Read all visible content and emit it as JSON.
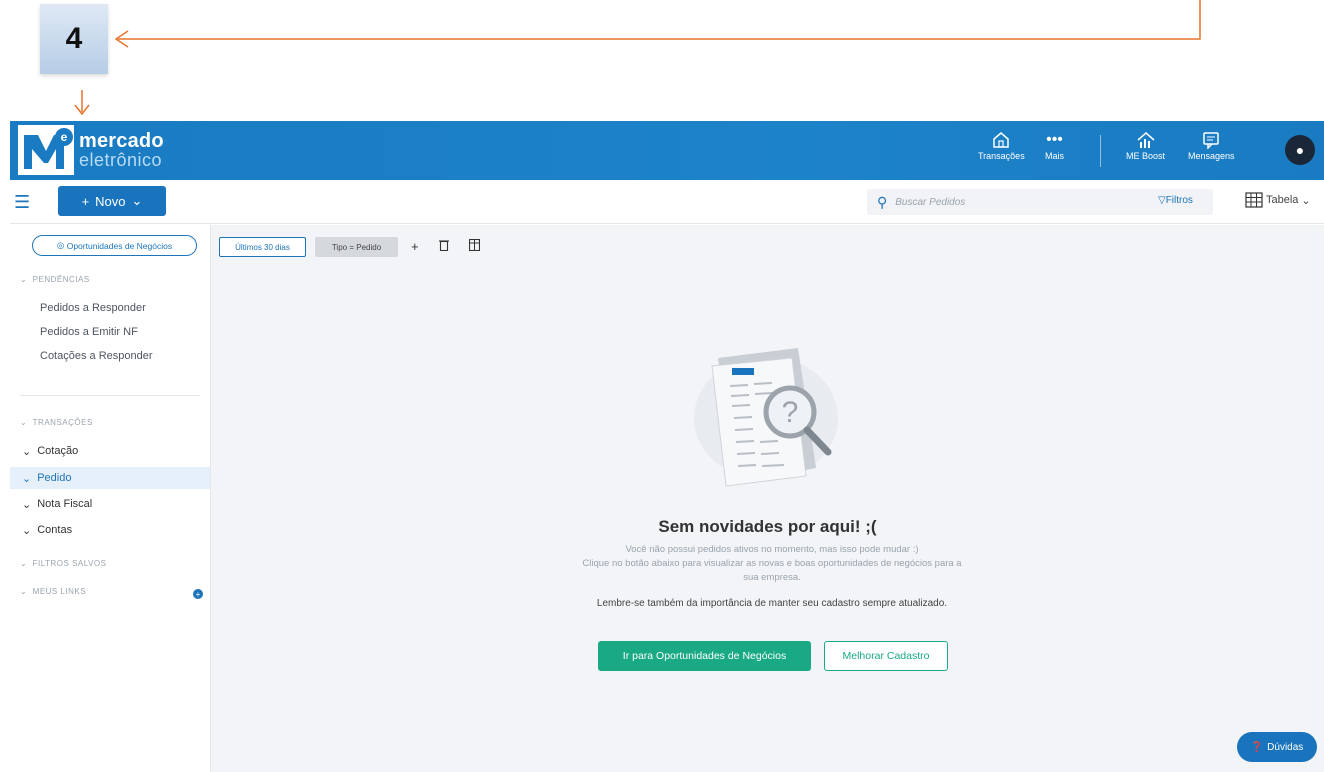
{
  "annotation": {
    "step": "4"
  },
  "header": {
    "logo_line1": "mercado",
    "logo_line2": "eletrônico",
    "nav": [
      {
        "label": "Transações",
        "icon": "home-icon"
      },
      {
        "label": "Mais",
        "icon": "more-dots-icon"
      },
      {
        "label": "ME Boost",
        "icon": "chart-icon"
      },
      {
        "label": "Mensagens",
        "icon": "message-icon"
      }
    ],
    "avatar_icon": "user-icon"
  },
  "toolbar": {
    "novo_label": "Novo",
    "search_placeholder": "Buscar Pedidos",
    "filtros_label": "Filtros",
    "view_label": "Tabela"
  },
  "sidebar": {
    "opportunities_label": "Oportunidades de Negócios",
    "pendencias_label": "PENDÊNCIAS",
    "pendencias_items": [
      "Pedidos a Responder",
      "Pedidos a Emitir NF",
      "Cotações a Responder"
    ],
    "transacoes_label": "TRANSAÇÕES",
    "transacoes_items": [
      "Cotação",
      "Pedido",
      "Nota Fiscal",
      "Contas"
    ],
    "active_item": "Pedido",
    "filtros_salvos_label": "FILTROS SALVOS",
    "meus_links_label": "MEUS LINKS"
  },
  "content": {
    "chip_period": "Últimos 30 dias",
    "chip_type": "Tipo = Pedido",
    "empty_title": "Sem novidades por aqui! ;(",
    "empty_line1": "Você não possui pedidos ativos no momento, mas isso pode mudar :)",
    "empty_line2": "Clique no botão abaixo para visualizar as novas e boas oportunidades de negócios para a sua empresa.",
    "empty_line3": "Lembre-se também da importância de manter seu cadastro sempre atualizado.",
    "btn_go_label": "Ir para Oportunidades de Negócios",
    "btn_improve_label": "Melhorar Cadastro",
    "duvidas_label": "Dúvidas"
  },
  "colors": {
    "header_blue": "#1a7bc2",
    "primary": "#1a74bd",
    "success": "#19a985",
    "annotation_arrow": "#e8742c"
  }
}
